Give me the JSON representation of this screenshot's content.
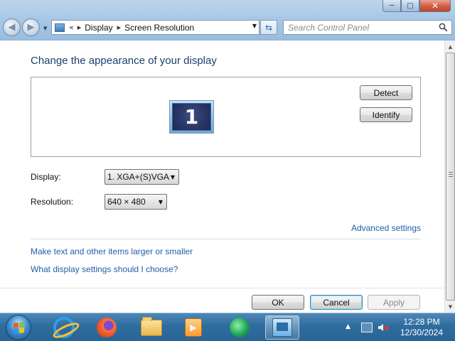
{
  "window": {
    "caption_buttons": {
      "minimize": "─",
      "maximize": "□",
      "close": "✕"
    },
    "address": {
      "crumbs": [
        "Display",
        "Screen Resolution"
      ],
      "overflow": "«"
    },
    "search": {
      "placeholder": "Search Control Panel"
    }
  },
  "page": {
    "title": "Change the appearance of your display",
    "monitor_number": "1",
    "detect_label": "Detect",
    "identify_label": "Identify",
    "display_label": "Display:",
    "display_value": "1. XGA+(S)VGA",
    "resolution_label": "Resolution:",
    "resolution_value": "640 × 480",
    "advanced_link": "Advanced settings",
    "larger_link": "Make text and other items larger or smaller",
    "choose_link": "What display settings should I choose?",
    "ok_label": "OK",
    "cancel_label": "Cancel",
    "apply_label": "Apply"
  },
  "taskbar": {
    "apps": [
      "internet-explorer",
      "firefox",
      "windows-explorer",
      "media-player",
      "media-center",
      "control-panel"
    ],
    "clock_time": "12:28 PM",
    "clock_date": "12/30/2024"
  }
}
